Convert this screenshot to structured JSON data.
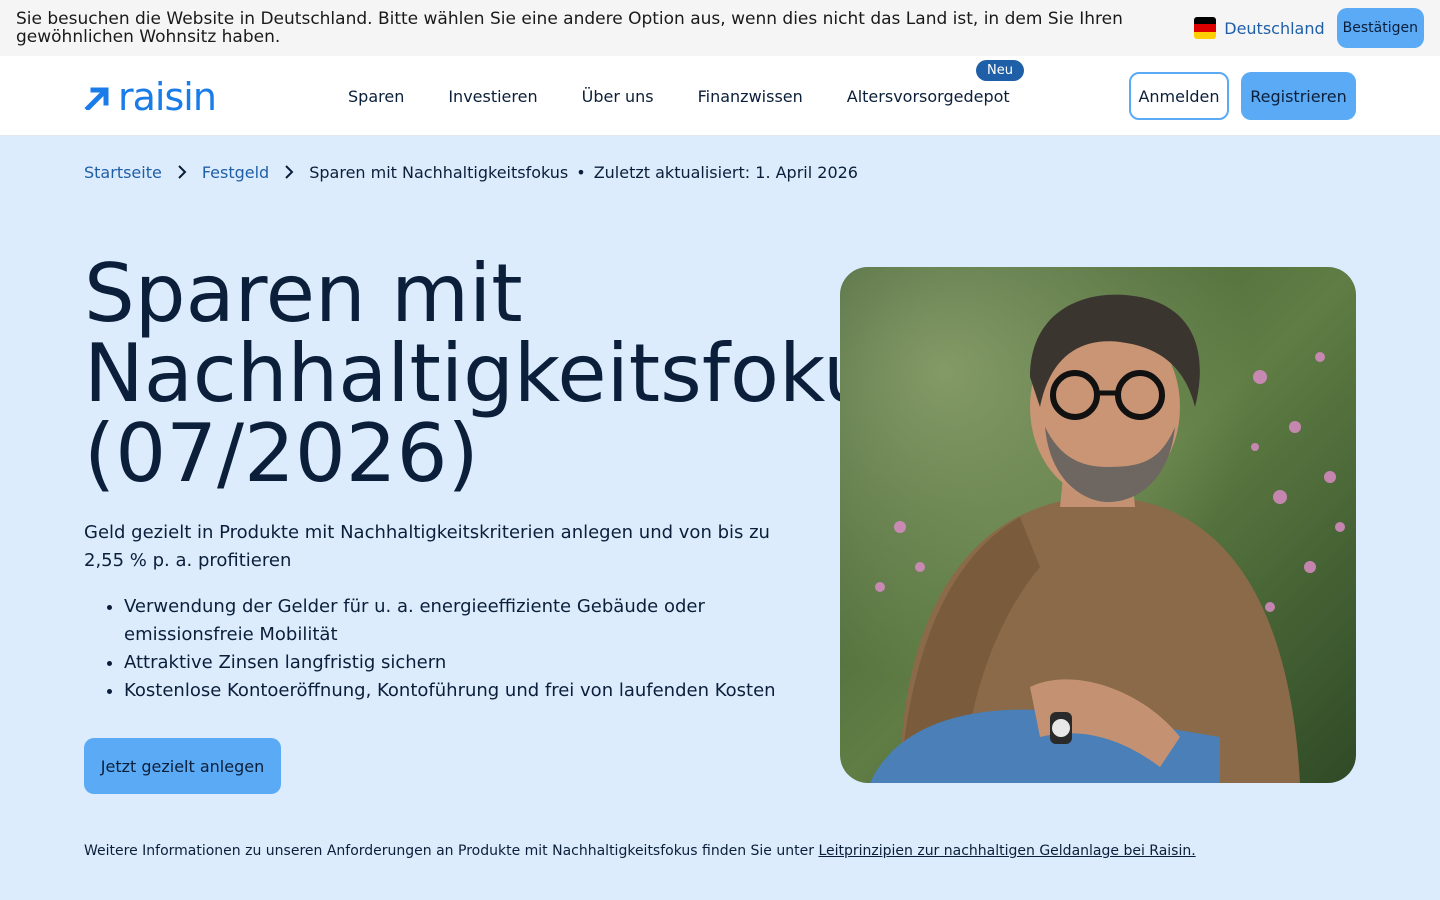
{
  "country_banner": {
    "text": "Sie besuchen die Website in Deutschland. Bitte wählen Sie eine andere Option aus, wenn dies nicht das Land ist, in dem Sie Ihren gewöhnlichen Wohnsitz haben.",
    "country": "Deutschland",
    "confirm_label": "Bestätigen"
  },
  "header": {
    "logo_text": "raisin",
    "nav": [
      "Sparen",
      "Investieren",
      "Über uns",
      "Finanzwissen",
      "Altersvorsorgedepot"
    ],
    "nav_badge": "Neu",
    "login_label": "Anmelden",
    "register_label": "Registrieren"
  },
  "breadcrumb": {
    "items": [
      "Startseite",
      "Festgeld"
    ],
    "current": "Sparen mit Nachhaltigkeitsfokus",
    "updated": "Zuletzt aktualisiert: 1. April 2026"
  },
  "hero": {
    "title_lines": [
      "Sparen mit",
      "Nachhaltigkeitsfokus",
      "(07/2026)"
    ],
    "intro": "Geld gezielt in Produkte mit Nachhaltigkeitskriterien anlegen und von bis zu 2,55 % p. a. profitieren",
    "bullets": [
      "Verwendung der Gelder für u. a. energieeffiziente Gebäude oder emissionsfreie Mobilität",
      "Attraktive Zinsen langfristig sichern",
      "Kostenlose Kontoeröffnung, Kontoführung und frei von laufenden Kosten"
    ],
    "cta_label": "Jetzt gezielt anlegen"
  },
  "footnote": {
    "text": "Weitere Informationen zu unseren Anforderungen an Produkte mit Nachhaltigkeitsfokus finden Sie unter ",
    "link": "Leitprinzipien zur nachhaltigen Geldanlage bei Raisin."
  },
  "colors": {
    "brand_blue": "#1a7ce8",
    "button_blue": "#5aaaf5",
    "page_bg": "#dcecfd",
    "dark_text": "#0b1f3a"
  }
}
